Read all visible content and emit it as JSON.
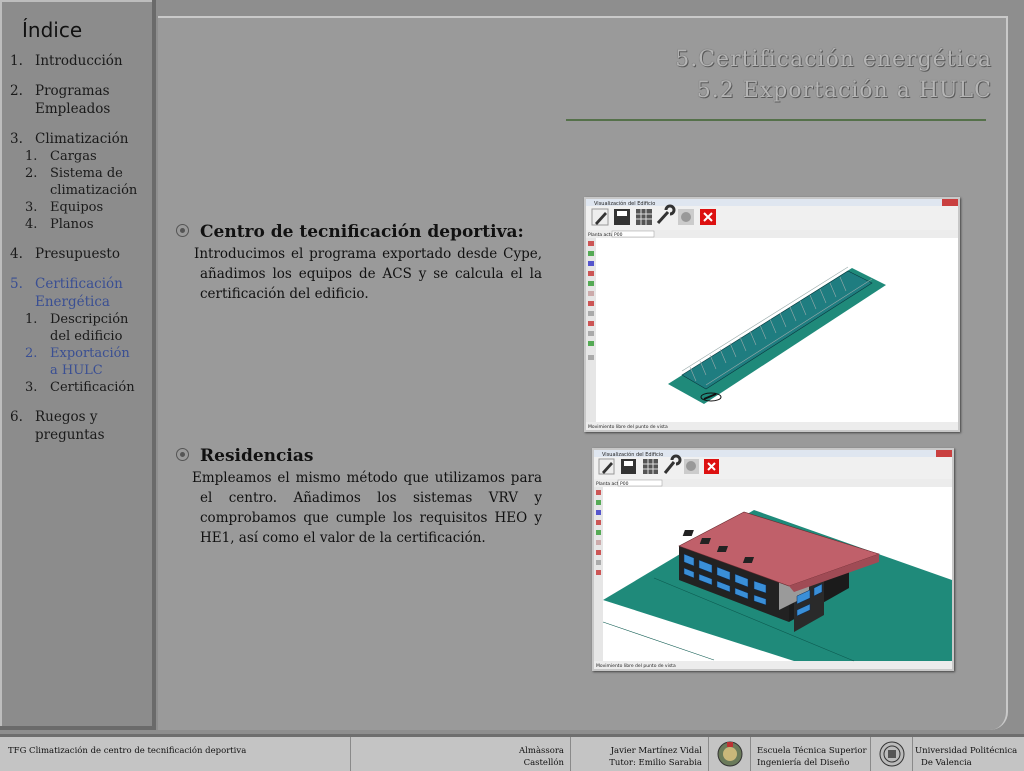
{
  "sidebar": {
    "title": "Índice",
    "items": [
      {
        "num": "1.",
        "label": "Introducción"
      },
      {
        "num": "2.",
        "label": "Programas Empleados"
      },
      {
        "num": "3.",
        "label": "Climatización",
        "subitems": [
          {
            "num": "1.",
            "label": "Cargas"
          },
          {
            "num": "2.",
            "label": "Sistema de climatización"
          },
          {
            "num": "3.",
            "label": "Equipos"
          },
          {
            "num": "4.",
            "label": "Planos"
          }
        ]
      },
      {
        "num": "4.",
        "label": "Presupuesto"
      },
      {
        "num": "5.",
        "label": "Certificación Energética",
        "subitems": [
          {
            "num": "1.",
            "label": "Descripción del edificio"
          },
          {
            "num": "2.",
            "label": "Exportación a HULC"
          },
          {
            "num": "3.",
            "label": "Certificación"
          }
        ]
      },
      {
        "num": "6.",
        "label": "Ruegos y preguntas"
      }
    ]
  },
  "heading": {
    "line1": "5.Certificación energética",
    "line2": "5.2 Exportación a HULC"
  },
  "sections": [
    {
      "title": "Centro de tecnificación deportiva:",
      "body": "Introducimos el programa exportado desde Cype, añadimos los equipos de ACS y se calcula el la certificación del edificio."
    },
    {
      "title": "Residencias",
      "body": "Empleamos el mismo método que utilizamos para el centro. Añadimos los sistemas VRV y comprobamos que cumple los requisitos HEO y HE1, así como el valor de la certificación."
    }
  ],
  "screenshots": {
    "window_title": "Visualización del Edificio",
    "plant_label": "Planta actual",
    "plant_value": "P00",
    "status_text": "Movimiento libre del punto de vista"
  },
  "footer": {
    "course": "TFG Climatización de centro de tecnificación deportiva",
    "place_line1": "Almàssora",
    "place_line2": "Castellón",
    "author_line1": "Javier Martínez Vidal",
    "author_line2": "Tutor: Emilio Sarabia",
    "school_line1": "Escuela Técnica Superior",
    "school_line2": "Ingeniería del Diseño",
    "uni_line1": "Universidad Politécnica",
    "uni_line2": "De Valencia"
  },
  "colors": {
    "active_item": "#3a4f93",
    "ground": "#1f8a7a",
    "roof": "#c0606a",
    "window_blue": "#3a8fd8"
  }
}
